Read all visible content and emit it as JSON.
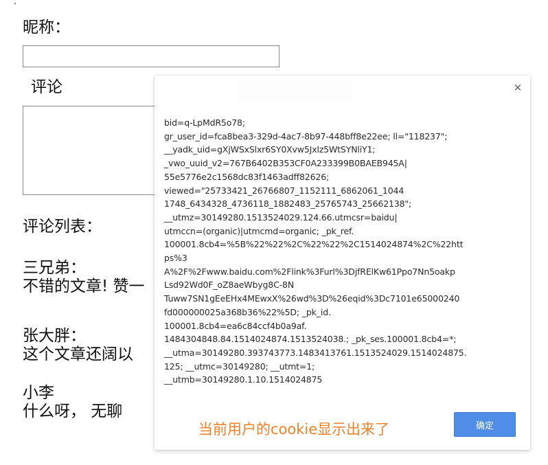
{
  "form": {
    "nickname_label": "昵称：",
    "nickname_value": "",
    "comment_label": "评论",
    "comment_value": ""
  },
  "comment_list": {
    "heading": "评论列表：",
    "items": [
      {
        "author": "三兄弟：",
        "text": "不错的文章! 赞一"
      },
      {
        "author": "张大胖：",
        "text": "这个文章还阔以"
      },
      {
        "author": "小李",
        "text": "什么呀， 无聊"
      }
    ]
  },
  "dialog": {
    "close_symbol": "×",
    "message_lines": [
      "bid=q-LpMdR5o78;",
      "gr_user_id=fca8bea3-329d-4ac7-8b97-448bff8e22ee; ll=\"118237\";",
      "__yadk_uid=gXjWSxSlxr6SY0Xvw5Jxlz5WtSYNliY1;",
      "_vwo_uuid_v2=767B6402B353CF0A233399B0BAEB945A|",
      "55e5776e2c1568dc83f1463adff82626;",
      "viewed=\"25733421_26766807_1152111_6862061_1044",
      "1748_6434328_4736118_1882483_25765743_25662138\";",
      "__utmz=30149280.1513524029.124.66.utmcsr=baidu|",
      "utmccn=(organic)|utmcmd=organic; _pk_ref.",
      "100001.8cb4=%5B%22%22%2C%22%22%2C1514024874%2C%22htt",
      "ps%3",
      "A%2F%2Fwww.baidu.com%2Flink%3Furl%3DjfRElKw61Ppo7Nn5oakp",
      "Lsd92Wd0F_oZ8aeWbyg8C-8N",
      "Tuww7SN1gEeEHx4MEwxX%26wd%3D%26eqid%3Dc7101e65000240",
      "fd000000025a368b36%22%5D; _pk_id.",
      "100001.8cb4=ea6c84ccf4b0a9af.",
      "1484304848.84.1514024874.1513524038.; _pk_ses.100001.8cb4=*;",
      "__utma=30149280.393743773.1483413761.1513524029.1514024875.",
      "125; __utmc=30149280; __utmt=1;",
      "__utmb=30149280.1.10.1514024875"
    ],
    "annotation": "当前用户的cookie显示出来了",
    "ok_label": "确定"
  }
}
